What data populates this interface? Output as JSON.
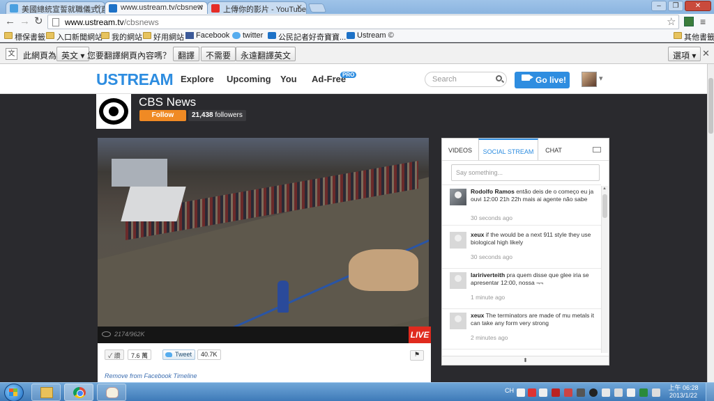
{
  "browser": {
    "tabs": [
      {
        "title": "美國總統宣誓就職儀式(直",
        "favicon": "pixnet-icon",
        "active": false
      },
      {
        "title": "www.ustream.tv/cbsnew",
        "favicon": "ustream-icon",
        "active": true
      },
      {
        "title": "上傳你的影片 - YouTube",
        "favicon": "youtube-icon",
        "active": false
      }
    ],
    "url_host": "www.ustream.tv",
    "url_path": "/cbsnews",
    "bookmarks": [
      {
        "label": "標保書籤",
        "icon": "folder-icon"
      },
      {
        "label": "入口新聞網站",
        "icon": "folder-icon"
      },
      {
        "label": "我的網站",
        "icon": "folder-icon"
      },
      {
        "label": "好用網站",
        "icon": "folder-icon"
      },
      {
        "label": "Facebook",
        "icon": "facebook-icon"
      },
      {
        "label": "twitter",
        "icon": "twitter-icon"
      },
      {
        "label": "公民記者好奇寶寶...",
        "icon": "ustream-icon"
      },
      {
        "label": "Ustream ©",
        "icon": "ustream-icon"
      }
    ],
    "other_bookmarks": "其他書籤"
  },
  "translate_bar": {
    "prefix": "此網頁為",
    "language": "英文",
    "question": "您要翻譯網頁內容嗎？",
    "translate_btn": "翻譯",
    "no_btn": "不需要",
    "always_btn": "永遠翻譯英文",
    "options_btn": "選項"
  },
  "header": {
    "logo": "USTREAM",
    "nav": [
      "Explore",
      "Upcoming",
      "You",
      "Ad-Free"
    ],
    "pro_badge": "PRO",
    "search_placeholder": "Search",
    "golive_label": "Go live!"
  },
  "channel": {
    "name": "CBS News",
    "follow_label": "Follow",
    "followers_count": "21,438",
    "followers_word": "followers"
  },
  "video": {
    "viewers": "2174/962K",
    "live_label": "LIVE"
  },
  "actions": {
    "like_label": "讚",
    "like_count": "7.6 萬",
    "tweet_label": "Tweet",
    "tweet_count": "40.7K",
    "remove_link": "Remove from Facebook Timeline"
  },
  "panel": {
    "tabs": [
      "VIDEOS",
      "SOCIAL STREAM",
      "CHAT"
    ],
    "active_tab": "SOCIAL STREAM",
    "say_placeholder": "Say something...",
    "posts": [
      {
        "author": "Rodolfo Ramos",
        "text": "então deis de o começo eu ja ouvi 12:00 21h 22h mais ai agente não sabe",
        "time": "30 seconds ago"
      },
      {
        "author": "xeux",
        "text": "if the would be a next 911 style they use biological high likely",
        "time": "30 seconds ago"
      },
      {
        "author": "laririverteith",
        "text": "pra quem disse que glee iria se apresentar 12:00, nossa ¬¬",
        "time": "1 minute ago"
      },
      {
        "author": "xeux",
        "text": "The terminators are made of mu metals it can take any form very strong",
        "time": "2 minutes ago"
      }
    ]
  },
  "taskbar": {
    "lang": "CH",
    "time": "上午 06:28",
    "date": "2013/1/22"
  }
}
